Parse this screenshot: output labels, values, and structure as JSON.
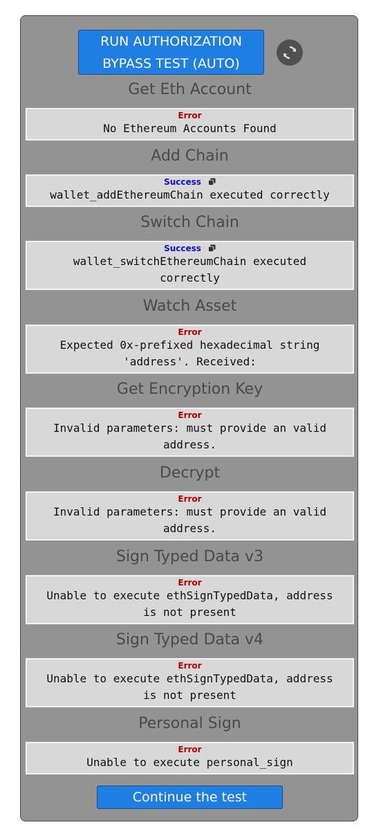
{
  "run_button": {
    "line1": "RUN AUTHORIZATION",
    "line2": "BYPASS TEST (AUTO)"
  },
  "refresh_icon": "refresh-icon",
  "colors": {
    "button": "#1e7ee2",
    "panel": "#939393",
    "error": "#b50000",
    "success": "#1010d0"
  },
  "sections": [
    {
      "title": "Get Eth Account",
      "status": "Error",
      "message": "No Ethereum Accounts Found"
    },
    {
      "title": "Add Chain",
      "status": "Success",
      "message": "wallet_addEthereumChain executed correctly"
    },
    {
      "title": "Switch Chain",
      "status": "Success",
      "message_line1": "wallet_switchEthereumChain executed",
      "message_line2": "correctly"
    },
    {
      "title": "Watch Asset",
      "status": "Error",
      "message_line1": "Expected 0x-prefixed hexadecimal string",
      "message_line2": "'address'. Received:"
    },
    {
      "title": "Get Encryption Key",
      "status": "Error",
      "message_line1": "Invalid parameters: must provide an valid",
      "message_line2": "address."
    },
    {
      "title": "Decrypt",
      "status": "Error",
      "message_line1": "Invalid parameters: must provide an valid",
      "message_line2": "address."
    },
    {
      "title": "Sign Typed Data v3",
      "status": "Error",
      "message_line1": "Unable to execute ethSignTypedData, address",
      "message_line2": "is not present"
    },
    {
      "title": "Sign Typed Data v4",
      "status": "Error",
      "message_line1": "Unable to execute ethSignTypedData, address",
      "message_line2": "is not present"
    },
    {
      "title": "Personal Sign",
      "status": "Error",
      "message": "Unable to execute personal_sign"
    }
  ],
  "continue_button": {
    "label": "Continue the test"
  }
}
